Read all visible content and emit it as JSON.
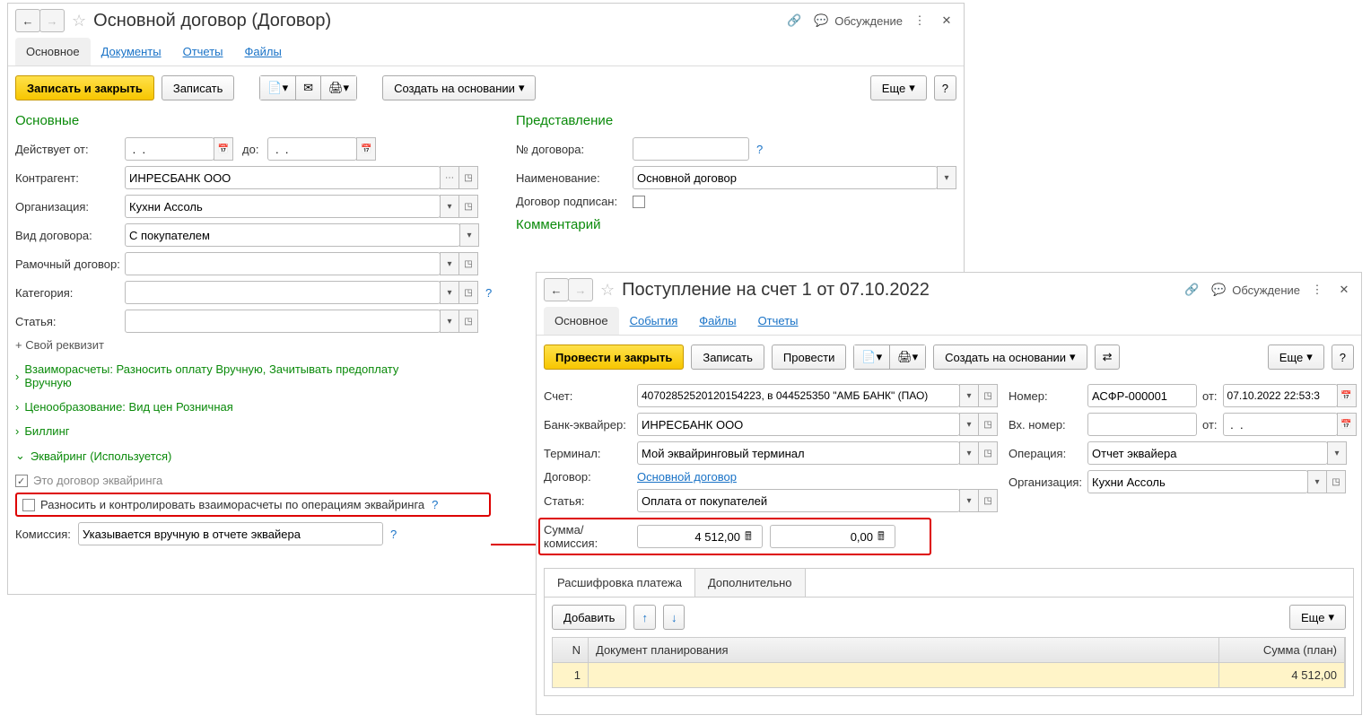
{
  "win1": {
    "title": "Основной договор (Договор)",
    "discuss": "Обсуждение",
    "tabs": {
      "main": "Основное",
      "docs": "Документы",
      "reports": "Отчеты",
      "files": "Файлы"
    },
    "toolbar": {
      "save_close": "Записать и закрыть",
      "save": "Записать",
      "create_based": "Создать на основании",
      "more": "Еще"
    },
    "section_main": "Основные",
    "section_repr": "Представление",
    "section_comment": "Комментарий",
    "labels": {
      "from": "Действует от:",
      "to": "до:",
      "counterparty": "Контрагент:",
      "org": "Организация:",
      "kind": "Вид договора:",
      "frame": "Рамочный договор:",
      "category": "Категория:",
      "article": "Статья:",
      "contract_no": "№ договора:",
      "name": "Наименование:",
      "signed": "Договор подписан:",
      "own_req": "+ Свой реквизит",
      "commission": "Комиссия:"
    },
    "values": {
      "date_from": " .  .",
      "date_to": " .  .",
      "counterparty": "ИНРЕСБАНК ООО",
      "org": "Кухни Ассоль",
      "kind": "С покупателем",
      "name": "Основной договор",
      "commission": "Указывается вручную в отчете эквайера"
    },
    "expanders": {
      "settlements": "Взаиморасчеты: Разносить оплату Вручную, Зачитывать предоплату Вручную",
      "pricing": "Ценообразование: Вид цен Розничная",
      "billing": "Биллинг",
      "acquiring": "Эквайринг (Используется)"
    },
    "acq": {
      "is_acq": "Это договор эквайринга",
      "spread": "Разносить и контролировать взаиморасчеты по операциям эквайринга"
    }
  },
  "win2": {
    "title": "Поступление на счет 1 от 07.10.2022",
    "discuss": "Обсуждение",
    "tabs": {
      "main": "Основное",
      "events": "События",
      "files": "Файлы",
      "reports": "Отчеты"
    },
    "toolbar": {
      "post_close": "Провести и закрыть",
      "save": "Записать",
      "post": "Провести",
      "create_based": "Создать на основании",
      "more": "Еще"
    },
    "labels": {
      "account": "Счет:",
      "bank": "Банк-эквайрер:",
      "terminal": "Терминал:",
      "contract": "Договор:",
      "article": "Статья:",
      "sum": "Сумма/комиссия:",
      "number": "Номер:",
      "from": "от:",
      "inno": "Вх. номер:",
      "infrom": "от:",
      "operation": "Операция:",
      "org": "Организация:"
    },
    "values": {
      "account": "40702852520120154223, в 044525350 \"АМБ БАНК\" (ПАО)",
      "bank": "ИНРЕСБАНК ООО",
      "terminal": "Мой эквайринговый терминал",
      "contract": "Основной договор",
      "article": "Оплата от покупателей",
      "sum": "4 512,00",
      "commission": "0,00",
      "number": "АСФР-000001",
      "date": "07.10.2022 22:53:3",
      "indate": " .  .",
      "operation": "Отчет эквайера",
      "org": "Кухни Ассоль"
    },
    "subtabs": {
      "breakdown": "Расшифровка платежа",
      "additional": "Дополнительно"
    },
    "tbl": {
      "add": "Добавить",
      "more": "Еще",
      "col_n": "N",
      "col_doc": "Документ планирования",
      "col_sum": "Сумма (план)",
      "r1_n": "1",
      "r1_sum": "4 512,00"
    }
  }
}
